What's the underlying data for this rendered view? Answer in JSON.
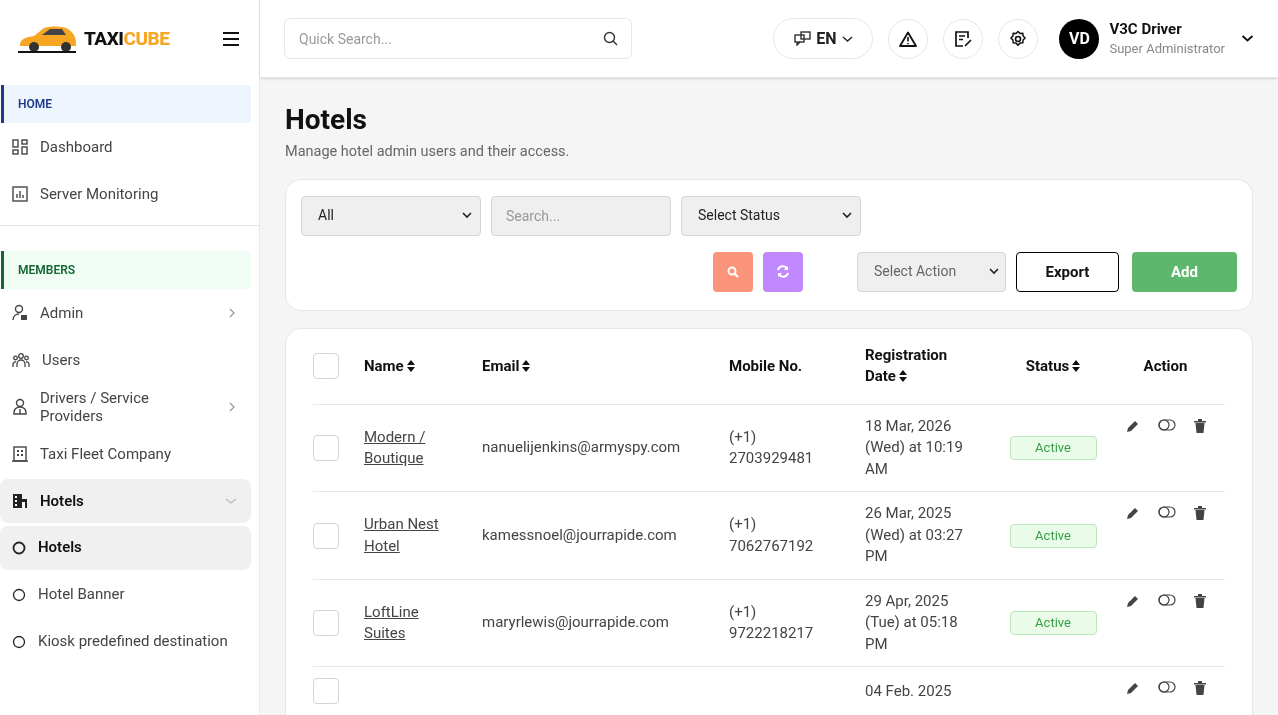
{
  "sidebar": {
    "logo": {
      "text_1": "TAXI",
      "text_2": "CUBE"
    },
    "sections": [
      {
        "title": "HOME",
        "color": "#1e3a8a",
        "items": [
          {
            "label": "Dashboard"
          },
          {
            "label": "Server Monitoring"
          }
        ]
      },
      {
        "title": "MEMBERS",
        "color": "#166534",
        "items": [
          {
            "label": "Admin",
            "expanded": false
          },
          {
            "label": "Users"
          },
          {
            "label": "Drivers / Service Providers",
            "expanded": false
          },
          {
            "label": "Taxi Fleet Company"
          },
          {
            "label": "Hotels",
            "expanded": true,
            "children": [
              {
                "label": "Hotels",
                "selected": true
              },
              {
                "label": "Hotel Banner",
                "selected": false
              },
              {
                "label": "Kiosk predefined destination",
                "selected": false
              }
            ]
          }
        ]
      }
    ]
  },
  "header": {
    "search": {
      "placeholder": "Quick Search..."
    },
    "language": "EN",
    "user": {
      "initials": "VD",
      "name": "V3C Driver",
      "role": "Super Administrator"
    }
  },
  "page": {
    "title": "Hotels",
    "subtitle": "Manage hotel admin users and their access."
  },
  "filters": {
    "type_select": "All",
    "search": {
      "placeholder": "Search..."
    },
    "status_select": "Select Status",
    "action_select": "Select Action",
    "buttons": [
      "Export",
      "Add"
    ]
  },
  "table": {
    "select_all": {
      "checked": false
    },
    "columns": [
      {
        "label": "Name",
        "sortable": true
      },
      {
        "label": "Email",
        "sortable": true
      },
      {
        "label": "Mobile No.",
        "sortable": false
      },
      {
        "label": "Registration Date",
        "sortable": true
      },
      {
        "label": "Status",
        "sortable": true
      },
      {
        "label": "Action",
        "sortable": false
      }
    ],
    "rows": [
      {
        "checked": false,
        "name": "Modern / Boutique",
        "email": "nanuelijenkins@armyspy.com",
        "mobile": "(+1) 2703929481",
        "registered": "18 Mar, 2026 (Wed) at 10:19 AM",
        "status": "Active"
      },
      {
        "checked": false,
        "name": "Urban Nest Hotel",
        "email": "kamessnoel@jourrapide.com",
        "mobile": "(+1) 7062767192",
        "registered": "26 Mar, 2025 (Wed) at 03:27 PM",
        "status": "Active"
      },
      {
        "checked": false,
        "name": "LoftLine Suites",
        "email": "maryrlewis@jourrapide.com",
        "mobile": "(+1) 9722218217",
        "registered": "29 Apr, 2025 (Tue) at 05:18 PM",
        "status": "Active"
      },
      {
        "checked": false,
        "registered": "04 Feb. 2025"
      }
    ]
  }
}
